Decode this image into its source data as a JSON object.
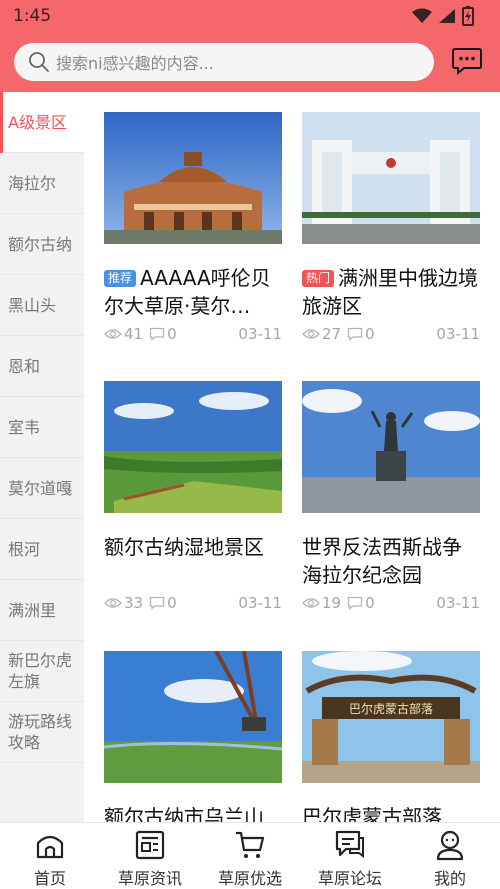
{
  "status_bar": {
    "time": "1:45"
  },
  "search": {
    "placeholder": "搜索ni感兴趣的内容..."
  },
  "sidebar": {
    "items": [
      {
        "label": "A级景区",
        "active": true
      },
      {
        "label": "海拉尔"
      },
      {
        "label": "额尔古纳"
      },
      {
        "label": "黑山头"
      },
      {
        "label": "恩和"
      },
      {
        "label": "室韦"
      },
      {
        "label": "莫尔道嘎"
      },
      {
        "label": "根河"
      },
      {
        "label": "满洲里"
      },
      {
        "label": "新巴尔虎左旗"
      },
      {
        "label": "游玩路线攻略"
      }
    ]
  },
  "cards": [
    {
      "tag": "推荐",
      "title": "AAAAA呼伦贝尔大草原·莫尔…",
      "views": "41",
      "comments": "0",
      "date": "03-11",
      "image": "theater-building-photo"
    },
    {
      "tag": "热门",
      "title": "满洲里中俄边境旅游区",
      "views": "27",
      "comments": "0",
      "date": "03-11",
      "image": "border-gate-photo"
    },
    {
      "tag": "",
      "title": "额尔古纳湿地景区",
      "views": "33",
      "comments": "0",
      "date": "03-11",
      "image": "wetland-photo"
    },
    {
      "tag": "",
      "title": "世界反法西斯战争海拉尔纪念园",
      "views": "19",
      "comments": "0",
      "date": "03-11",
      "image": "memorial-statue-photo"
    },
    {
      "tag": "",
      "title": "额尔古纳市乌兰山",
      "image": "swing-hill-photo"
    },
    {
      "tag": "",
      "title": "巴尔虎蒙古部落",
      "image": "mongol-tribe-gate-photo"
    }
  ],
  "tabbar": {
    "items": [
      {
        "label": "首页",
        "icon": "home-icon"
      },
      {
        "label": "草原资讯",
        "icon": "news-icon"
      },
      {
        "label": "草原优选",
        "icon": "cart-icon"
      },
      {
        "label": "草原论坛",
        "icon": "forum-icon"
      },
      {
        "label": "我的",
        "icon": "profile-icon"
      }
    ]
  },
  "colors": {
    "accent": "#f4676a",
    "active_text": "#f25357",
    "tag_recommend": "#4a90e2",
    "tag_hot": "#f25357"
  }
}
